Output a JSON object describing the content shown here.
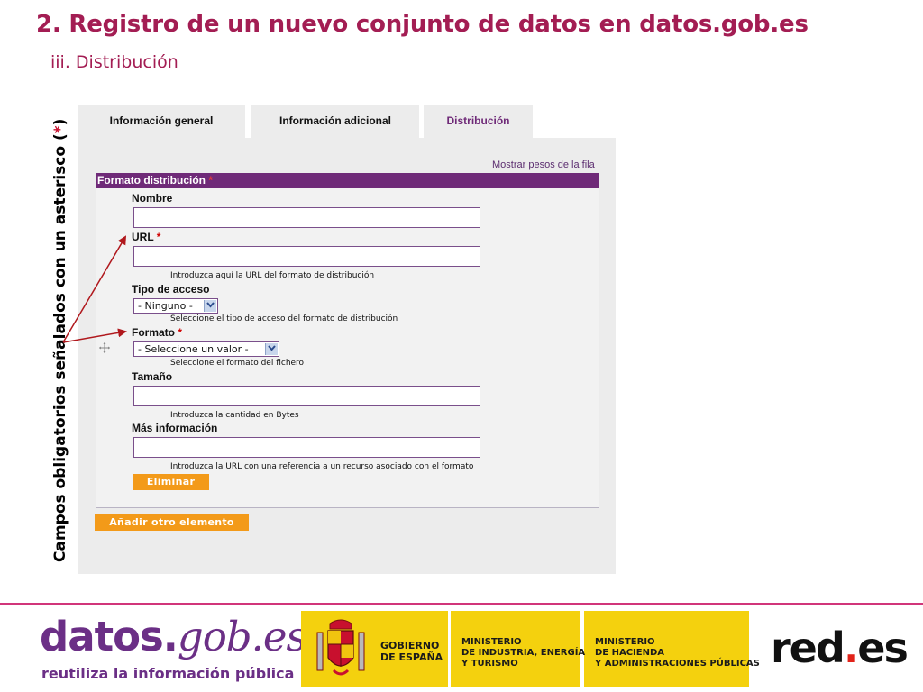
{
  "slide": {
    "title": "2. Registro de un nuevo conjunto de datos en datos.gob.es",
    "subtitle": "iii.  Distribución",
    "note_prefix": "Campos obligatorios señalados con un asterisco (",
    "note_star": "*",
    "note_suffix": ")"
  },
  "tabs": [
    {
      "label": "Información general",
      "active": false
    },
    {
      "label": "Información adicional",
      "active": false
    },
    {
      "label": "Distribución",
      "active": true
    }
  ],
  "form": {
    "show_weights_link": "Mostrar pesos de la fila",
    "fieldset_legend": "Formato distribución",
    "required_mark": "*",
    "fields": {
      "nombre": {
        "label": "Nombre",
        "value": ""
      },
      "url": {
        "label": "URL",
        "value": "",
        "hint": "Introduzca aquí la URL del formato de distribución"
      },
      "tipo_acceso": {
        "label": "Tipo de acceso",
        "selected": "- Ninguno -",
        "hint": "Seleccione el tipo de acceso del formato de distribución"
      },
      "formato": {
        "label": "Formato",
        "selected": "- Seleccione un valor -",
        "hint": "Seleccione el formato del fichero"
      },
      "tamano": {
        "label": "Tamaño",
        "value": "",
        "hint": "Introduzca la cantidad en Bytes"
      },
      "mas_info": {
        "label": "Más información",
        "value": "",
        "hint": "Introduzca la URL con una referencia a un recurso asociado con el formato"
      }
    },
    "delete_button": "Eliminar",
    "add_button": "Añadir otro elemento"
  },
  "footer": {
    "datos_logo_main": "datos.",
    "datos_logo_gob": "gob.es",
    "datos_tagline": "reutiliza la información pública",
    "gobierno": [
      "GOBIERNO",
      "DE ESPAÑA"
    ],
    "ministerio_industria": [
      "MINISTERIO",
      "DE INDUSTRIA, ENERGÍA",
      "Y TURISMO"
    ],
    "ministerio_hacienda": [
      "MINISTERIO",
      "DE HACIENDA",
      "Y ADMINISTRACIONES PÚBLICAS"
    ],
    "redes_part1": "red",
    "redes_dot": ".",
    "redes_part2": "es"
  },
  "colors": {
    "title": "#a31d53",
    "accent_purple": "#6f2a78",
    "button_orange": "#f39a19",
    "arrow_red": "#b0181d",
    "ministry_yellow": "#f4d10e"
  },
  "icons": [
    "drag-handle-icon",
    "chevron-down-icon",
    "coat-of-arms-icon"
  ]
}
